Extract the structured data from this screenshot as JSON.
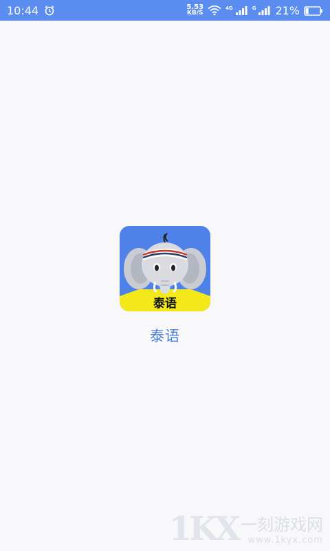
{
  "status_bar": {
    "time": "10:44",
    "speed_value": "5.53",
    "speed_unit": "KB/S",
    "net_tag_1": "4G",
    "net_tag_2": "G",
    "battery_percent": "21%",
    "battery_level": 0.21,
    "icons": [
      "alarm-icon",
      "wifi-icon",
      "signal-icon",
      "signal-icon",
      "battery-icon"
    ]
  },
  "splash": {
    "app_icon_label": "泰语",
    "app_name": "泰语"
  },
  "watermark": {
    "main": "一刻游戏网",
    "url": "www.1kyx.com"
  },
  "colors": {
    "status_bar": "#5a8def",
    "icon_background": "#4f82e8",
    "banner": "#f3e91a",
    "app_name": "#4a7fd4",
    "page_background": "#f8f8fa"
  }
}
